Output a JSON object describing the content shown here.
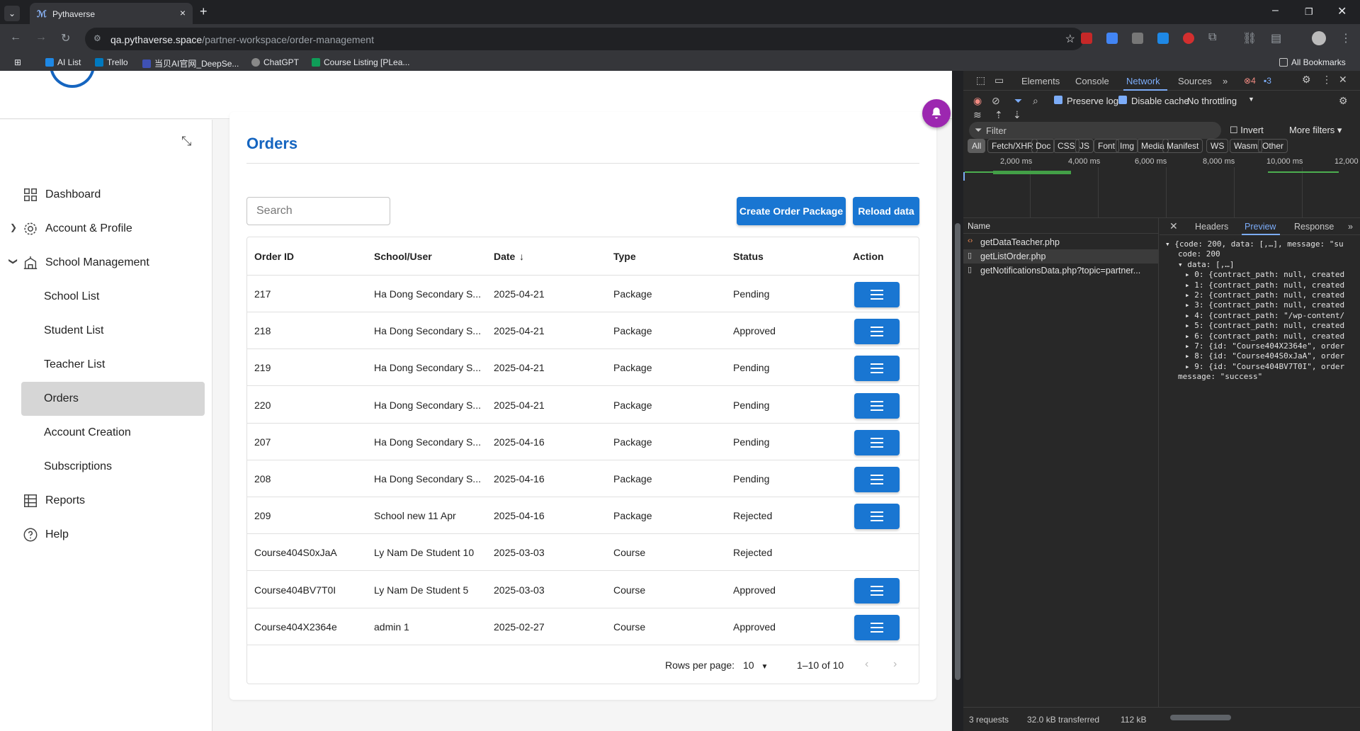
{
  "browser": {
    "tab_title": "Pythaverse",
    "url_host": "qa.pythaverse.space",
    "url_path": "/partner-workspace/order-management",
    "bookmarks": [
      "AI List",
      "Trello",
      "当贝AI官网_DeepSe...",
      "ChatGPT",
      "Course Listing [PLea..."
    ],
    "all_bookmarks": "All Bookmarks"
  },
  "sidebar": {
    "items": [
      {
        "label": "Dashboard",
        "icon": "grid-icon"
      },
      {
        "label": "Account & Profile",
        "icon": "gear-icon"
      },
      {
        "label": "School Management",
        "icon": "school-icon"
      }
    ],
    "sub_items": [
      {
        "label": "School List"
      },
      {
        "label": "Student List"
      },
      {
        "label": "Teacher List"
      },
      {
        "label": "Orders"
      },
      {
        "label": "Account Creation"
      },
      {
        "label": "Subscriptions"
      }
    ],
    "bottom_items": [
      {
        "label": "Reports",
        "icon": "table-icon"
      },
      {
        "label": "Help",
        "icon": "help-icon"
      }
    ]
  },
  "orders": {
    "title": "Orders",
    "search_placeholder": "Search",
    "create_btn": "Create Order Package",
    "reload_btn": "Reload data",
    "columns": [
      "Order ID",
      "School/User",
      "Date",
      "Type",
      "Status",
      "Action"
    ],
    "rows": [
      {
        "id": "217",
        "school": "Ha Dong Secondary S...",
        "date": "2025-04-21",
        "type": "Package",
        "status": "Pending",
        "action": true
      },
      {
        "id": "218",
        "school": "Ha Dong Secondary S...",
        "date": "2025-04-21",
        "type": "Package",
        "status": "Approved",
        "action": true
      },
      {
        "id": "219",
        "school": "Ha Dong Secondary S...",
        "date": "2025-04-21",
        "type": "Package",
        "status": "Pending",
        "action": true
      },
      {
        "id": "220",
        "school": "Ha Dong Secondary S...",
        "date": "2025-04-21",
        "type": "Package",
        "status": "Pending",
        "action": true
      },
      {
        "id": "207",
        "school": "Ha Dong Secondary S...",
        "date": "2025-04-16",
        "type": "Package",
        "status": "Pending",
        "action": true
      },
      {
        "id": "208",
        "school": "Ha Dong Secondary S...",
        "date": "2025-04-16",
        "type": "Package",
        "status": "Pending",
        "action": true
      },
      {
        "id": "209",
        "school": "School new 11 Apr",
        "date": "2025-04-16",
        "type": "Package",
        "status": "Rejected",
        "action": true
      },
      {
        "id": "Course404S0xJaA",
        "school": "Ly Nam De Student 10",
        "date": "2025-03-03",
        "type": "Course",
        "status": "Rejected",
        "action": false
      },
      {
        "id": "Course404BV7T0I",
        "school": "Ly Nam De Student 5",
        "date": "2025-03-03",
        "type": "Course",
        "status": "Approved",
        "action": true
      },
      {
        "id": "Course404X2364e",
        "school": "admin 1",
        "date": "2025-02-27",
        "type": "Course",
        "status": "Approved",
        "action": true
      }
    ],
    "rows_per_page_label": "Rows per page:",
    "rows_per_page": "10",
    "range": "1–10 of 10"
  },
  "devtools": {
    "tabs": [
      "Elements",
      "Console",
      "Network",
      "Sources"
    ],
    "errors": "4",
    "warnings": "3",
    "preserve_log": "Preserve log",
    "disable_cache": "Disable cache",
    "throttling": "No throttling",
    "filter_placeholder": "Filter",
    "invert": "Invert",
    "more_filters": "More filters",
    "types": [
      "All",
      "Fetch/XHR",
      "Doc",
      "CSS",
      "JS",
      "Font",
      "Img",
      "Media",
      "Manifest",
      "WS",
      "Wasm",
      "Other"
    ],
    "timeline_labels": [
      "2,000 ms",
      "4,000 ms",
      "6,000 ms",
      "8,000 ms",
      "10,000 ms",
      "12,000"
    ],
    "name_header": "Name",
    "requests": [
      "getDataTeacher.php",
      "getListOrder.php",
      "getNotificationsData.php?topic=partner..."
    ],
    "detail_tabs": [
      "Headers",
      "Preview",
      "Response"
    ],
    "json_lines": [
      "{code: 200, data: [,…], message: \"su",
      "code: 200",
      "data: [,…]",
      "0: {contract_path: null, created",
      "1: {contract_path: null, created",
      "2: {contract_path: null, created",
      "3: {contract_path: null, created",
      "4: {contract_path: \"/wp-content/",
      "5: {contract_path: null, created",
      "6: {contract_path: null, created",
      "7: {id: \"Course404X2364e\", order",
      "8: {id: \"Course404S0xJaA\", order",
      "9: {id: \"Course404BV7T0I\", order",
      "message: \"success\""
    ],
    "status_requests": "3 requests",
    "status_transferred": "32.0 kB transferred",
    "status_size": "112 kB"
  }
}
